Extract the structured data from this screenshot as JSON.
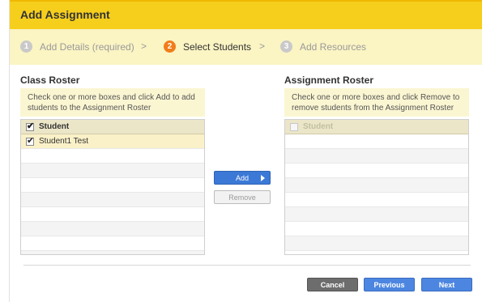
{
  "dialog": {
    "title": "Add Assignment"
  },
  "steps": [
    {
      "num": "1",
      "label": "Add Details (required)",
      "active": false
    },
    {
      "num": "2",
      "label": "Select Students",
      "active": true
    },
    {
      "num": "3",
      "label": "Add Resources",
      "active": false
    }
  ],
  "step_separator": ">",
  "class_roster": {
    "heading": "Class Roster",
    "instructions": "Check one or more boxes and click Add to add students to the Assignment Roster",
    "header_label": "Student",
    "rows": [
      {
        "label": "Student1 Test",
        "checked": true
      }
    ]
  },
  "assignment_roster": {
    "heading": "Assignment Roster",
    "instructions": "Check one or more boxes and click Remove to remove students from the Assignment Roster",
    "header_label": "Student",
    "rows": []
  },
  "buttons": {
    "add": "Add",
    "remove": "Remove",
    "cancel": "Cancel",
    "previous": "Previous",
    "next": "Next"
  },
  "colors": {
    "title_bar": "#f6cf1c",
    "steps_bar": "#fbf4c3",
    "active_step": "#f07d1a",
    "primary_button": "#4c86e0",
    "cancel_button": "#6d6d6d"
  }
}
